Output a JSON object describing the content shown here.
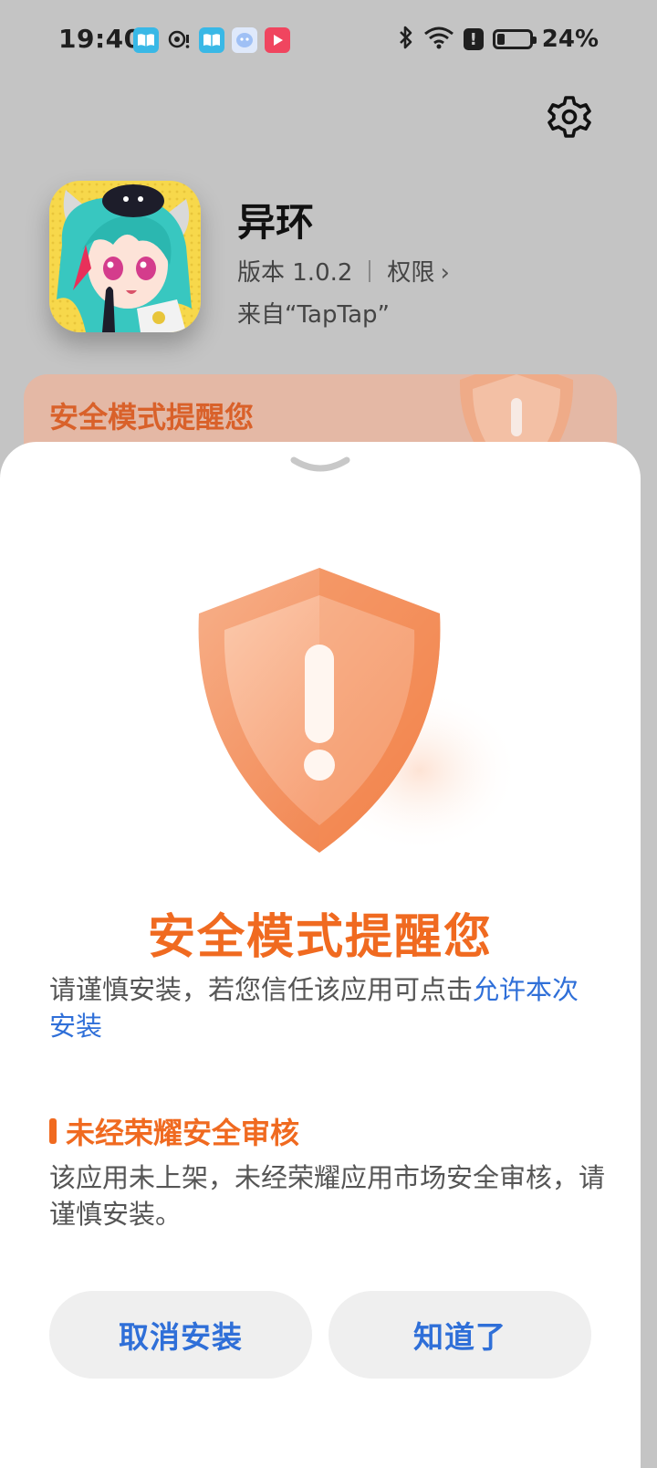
{
  "status_bar": {
    "time": "19:40",
    "battery_percent": "24%",
    "battery_level": 0.24,
    "notification_icons": [
      "book-app-icon",
      "qq-icon",
      "book-app-icon",
      "chat-app-icon",
      "video-app-icon"
    ],
    "right_icons": [
      "bluetooth-icon",
      "wifi-icon",
      "alert-icon",
      "battery-icon"
    ]
  },
  "app": {
    "name": "异环",
    "version_label": "版本 1.0.2",
    "permissions_label": "权限",
    "source_label": "来自“TapTap”"
  },
  "background_banner": {
    "title": "安全模式提醒您"
  },
  "sheet": {
    "title": "安全模式提醒您",
    "description_prefix": "请谨慎安装，若您信任该应用可点击",
    "description_link": "允许本次安装",
    "section_title": "未经荣耀安全审核",
    "section_body": "该应用未上架，未经荣耀应用市场安全审核，请谨慎安装。",
    "cancel_button": "取消安装",
    "ok_button": "知道了"
  },
  "colors": {
    "accent_orange": "#f06a20",
    "link_blue": "#2f6fd8",
    "dimmed_background": "#c4c4c4"
  }
}
